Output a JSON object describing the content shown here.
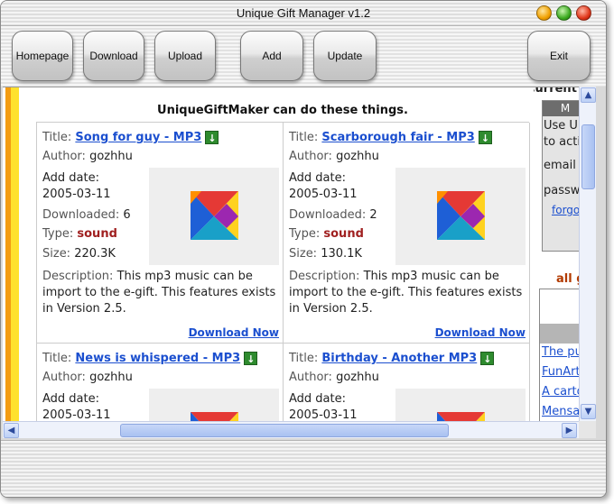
{
  "window": {
    "title": "Unique Gift Manager v1.2"
  },
  "toolbar": {
    "homepage": "Homepage",
    "download": "Download",
    "upload": "Upload",
    "add": "Add",
    "update": "Update",
    "exit": "Exit"
  },
  "content": {
    "heading": "UniqueGiftMaker can do these things."
  },
  "labels": {
    "title": "Title:",
    "author": "Author:",
    "add_date": "Add date:",
    "downloaded": "Downloaded:",
    "type": "Type:",
    "size": "Size:",
    "description": "Description:"
  },
  "cards": [
    {
      "title": "Song for guy - MP3",
      "author": "gozhhu",
      "add_date": "2005-03-11",
      "downloaded": "6",
      "type": "sound",
      "size": "220.3K",
      "description": "This mp3 music can be import to the e-gift. This features exists in Version 2.5.",
      "download_link": "Download Now"
    },
    {
      "title": "Scarborough fair - MP3",
      "author": "gozhhu",
      "add_date": "2005-03-11",
      "downloaded": "2",
      "type": "sound",
      "size": "130.1K",
      "description": "This mp3 music can be import to the e-gift. This features exists in Version 2.5.",
      "download_link": "Download Now"
    },
    {
      "title": "News is whispered - MP3",
      "author": "gozhhu",
      "add_date": "2005-03-11"
    },
    {
      "title": "Birthday - Another MP3",
      "author": "gozhhu",
      "add_date": "2005-03-11"
    }
  ],
  "sidebar": {
    "heading": "Current L",
    "login_bar": "M",
    "line1": "Use Ur",
    "line2": "to activ",
    "email_label": "email",
    "password_label": "passw",
    "forgot_link": "forgot",
    "all_label": "all g",
    "games": [
      "The puz",
      "FunArt",
      "A carto",
      "Mensa"
    ]
  },
  "colors": {
    "link": "#1b4fcf",
    "type_value": "#a02020",
    "stripe_orange": "#f39c12",
    "stripe_yellow": "#ffe12e"
  },
  "icons": {
    "download_badge": "green-download-arrow-icon",
    "thumbnail": "tangram-gift-logo-icon"
  }
}
